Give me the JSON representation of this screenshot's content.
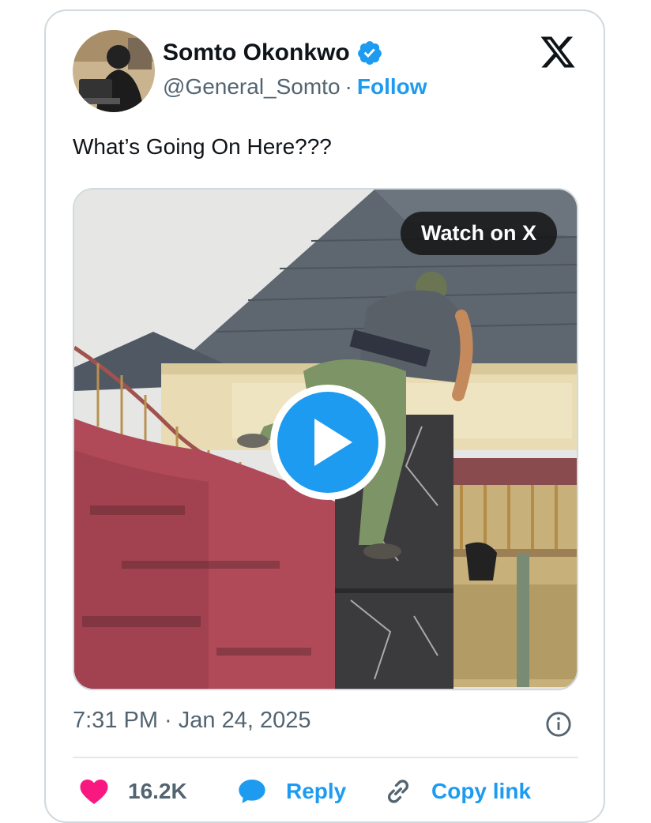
{
  "author": {
    "name": "Somto Okonkwo",
    "handle": "@General_Somto",
    "separator": "·",
    "follow_label": "Follow"
  },
  "tweet": {
    "text": "What’s Going On Here???",
    "timestamp": "7:31 PM · Jan 24, 2025"
  },
  "media": {
    "watch_label": "Watch on X"
  },
  "actions": {
    "likes_count": "16.2K",
    "reply_label": "Reply",
    "copy_link_label": "Copy link"
  },
  "colors": {
    "accent": "#1d9bf0",
    "like": "#f91880",
    "text": "#0f1419",
    "muted": "#536471"
  },
  "icons": [
    "verified-badge-icon",
    "x-logo-icon",
    "play-icon",
    "info-icon",
    "heart-icon",
    "reply-bubble-icon",
    "link-icon"
  ]
}
